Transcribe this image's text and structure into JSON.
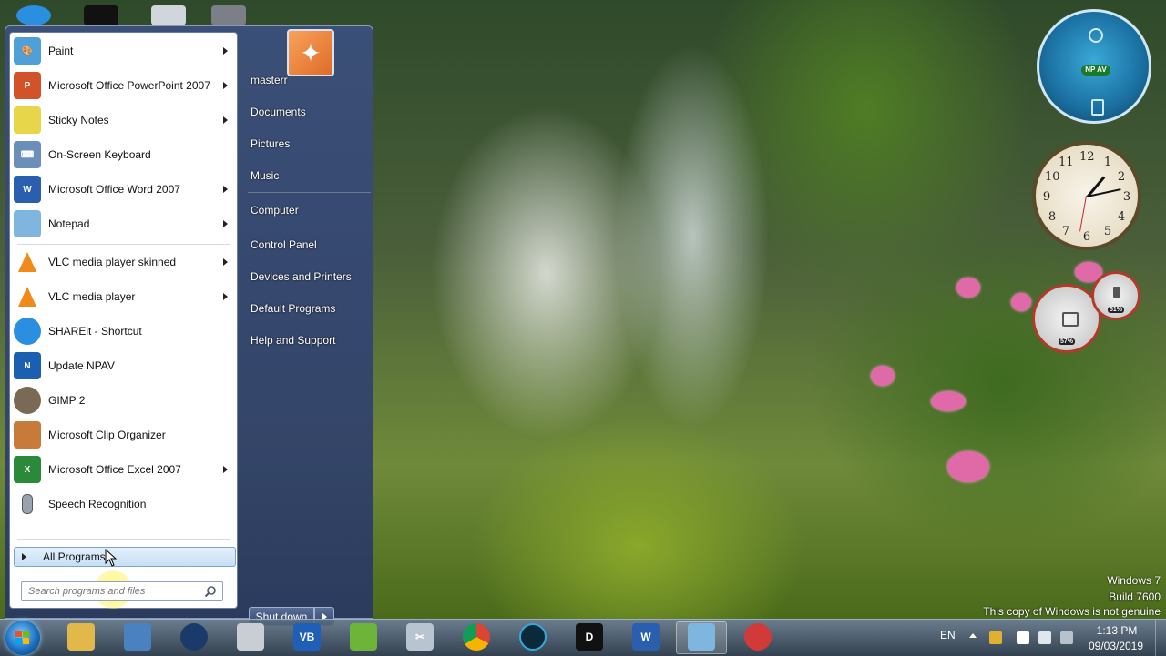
{
  "start_menu": {
    "programs": [
      {
        "label": "Paint",
        "has_submenu": true,
        "icon": "paint-icon",
        "color": "#4f9fd8"
      },
      {
        "label": "Microsoft Office PowerPoint 2007",
        "has_submenu": true,
        "icon": "powerpoint-icon",
        "color": "#d2522a"
      },
      {
        "label": "Sticky Notes",
        "has_submenu": true,
        "icon": "sticky-notes-icon",
        "color": "#e8d64a"
      },
      {
        "label": "On-Screen Keyboard",
        "has_submenu": false,
        "icon": "keyboard-icon",
        "color": "#6b8fb8"
      },
      {
        "label": "Microsoft Office Word 2007",
        "has_submenu": true,
        "icon": "word-icon",
        "color": "#2a5fb0"
      },
      {
        "label": "Notepad",
        "has_submenu": true,
        "icon": "notepad-icon",
        "color": "#7fb6e0"
      },
      {
        "label": "VLC media player skinned",
        "has_submenu": true,
        "icon": "vlc-icon",
        "color": "#f08a1a"
      },
      {
        "label": "VLC media player",
        "has_submenu": true,
        "icon": "vlc-icon",
        "color": "#f08a1a"
      },
      {
        "label": "SHAREit - Shortcut",
        "has_submenu": false,
        "icon": "shareit-icon",
        "color": "#2a8fe0"
      },
      {
        "label": "Update NPAV",
        "has_submenu": false,
        "icon": "npav-update-icon",
        "color": "#1a5fb0"
      },
      {
        "label": "GIMP 2",
        "has_submenu": false,
        "icon": "gimp-icon",
        "color": "#7a6a55"
      },
      {
        "label": "Microsoft Clip Organizer",
        "has_submenu": false,
        "icon": "clip-organizer-icon",
        "color": "#c77a3a"
      },
      {
        "label": "Microsoft Office Excel 2007",
        "has_submenu": true,
        "icon": "excel-icon",
        "color": "#2a8a3a"
      },
      {
        "label": "Speech Recognition",
        "has_submenu": false,
        "icon": "microphone-icon",
        "color": "#9aa3ad"
      }
    ],
    "all_programs_label": "All Programs",
    "search_placeholder": "Search programs and files",
    "right_items": {
      "user": "masterr",
      "documents": "Documents",
      "pictures": "Pictures",
      "music": "Music",
      "computer": "Computer",
      "control_panel": "Control Panel",
      "devices": "Devices and Printers",
      "default_programs": "Default Programs",
      "help": "Help and Support"
    },
    "shutdown_label": "Shut down"
  },
  "gadgets": {
    "npav_badge": "NP AV",
    "clock_numbers": [
      "12",
      "1",
      "2",
      "3",
      "4",
      "5",
      "6",
      "7",
      "8",
      "9",
      "10",
      "11"
    ],
    "cpu_percent": "57%",
    "memory_percent": "51%"
  },
  "watermark": {
    "line1": "Windows 7",
    "line2": "Build 7600",
    "line3": "This copy of Windows is not genuine"
  },
  "taskbar": {
    "language": "EN",
    "time": "1:13 PM",
    "date": "09/03/2019"
  }
}
